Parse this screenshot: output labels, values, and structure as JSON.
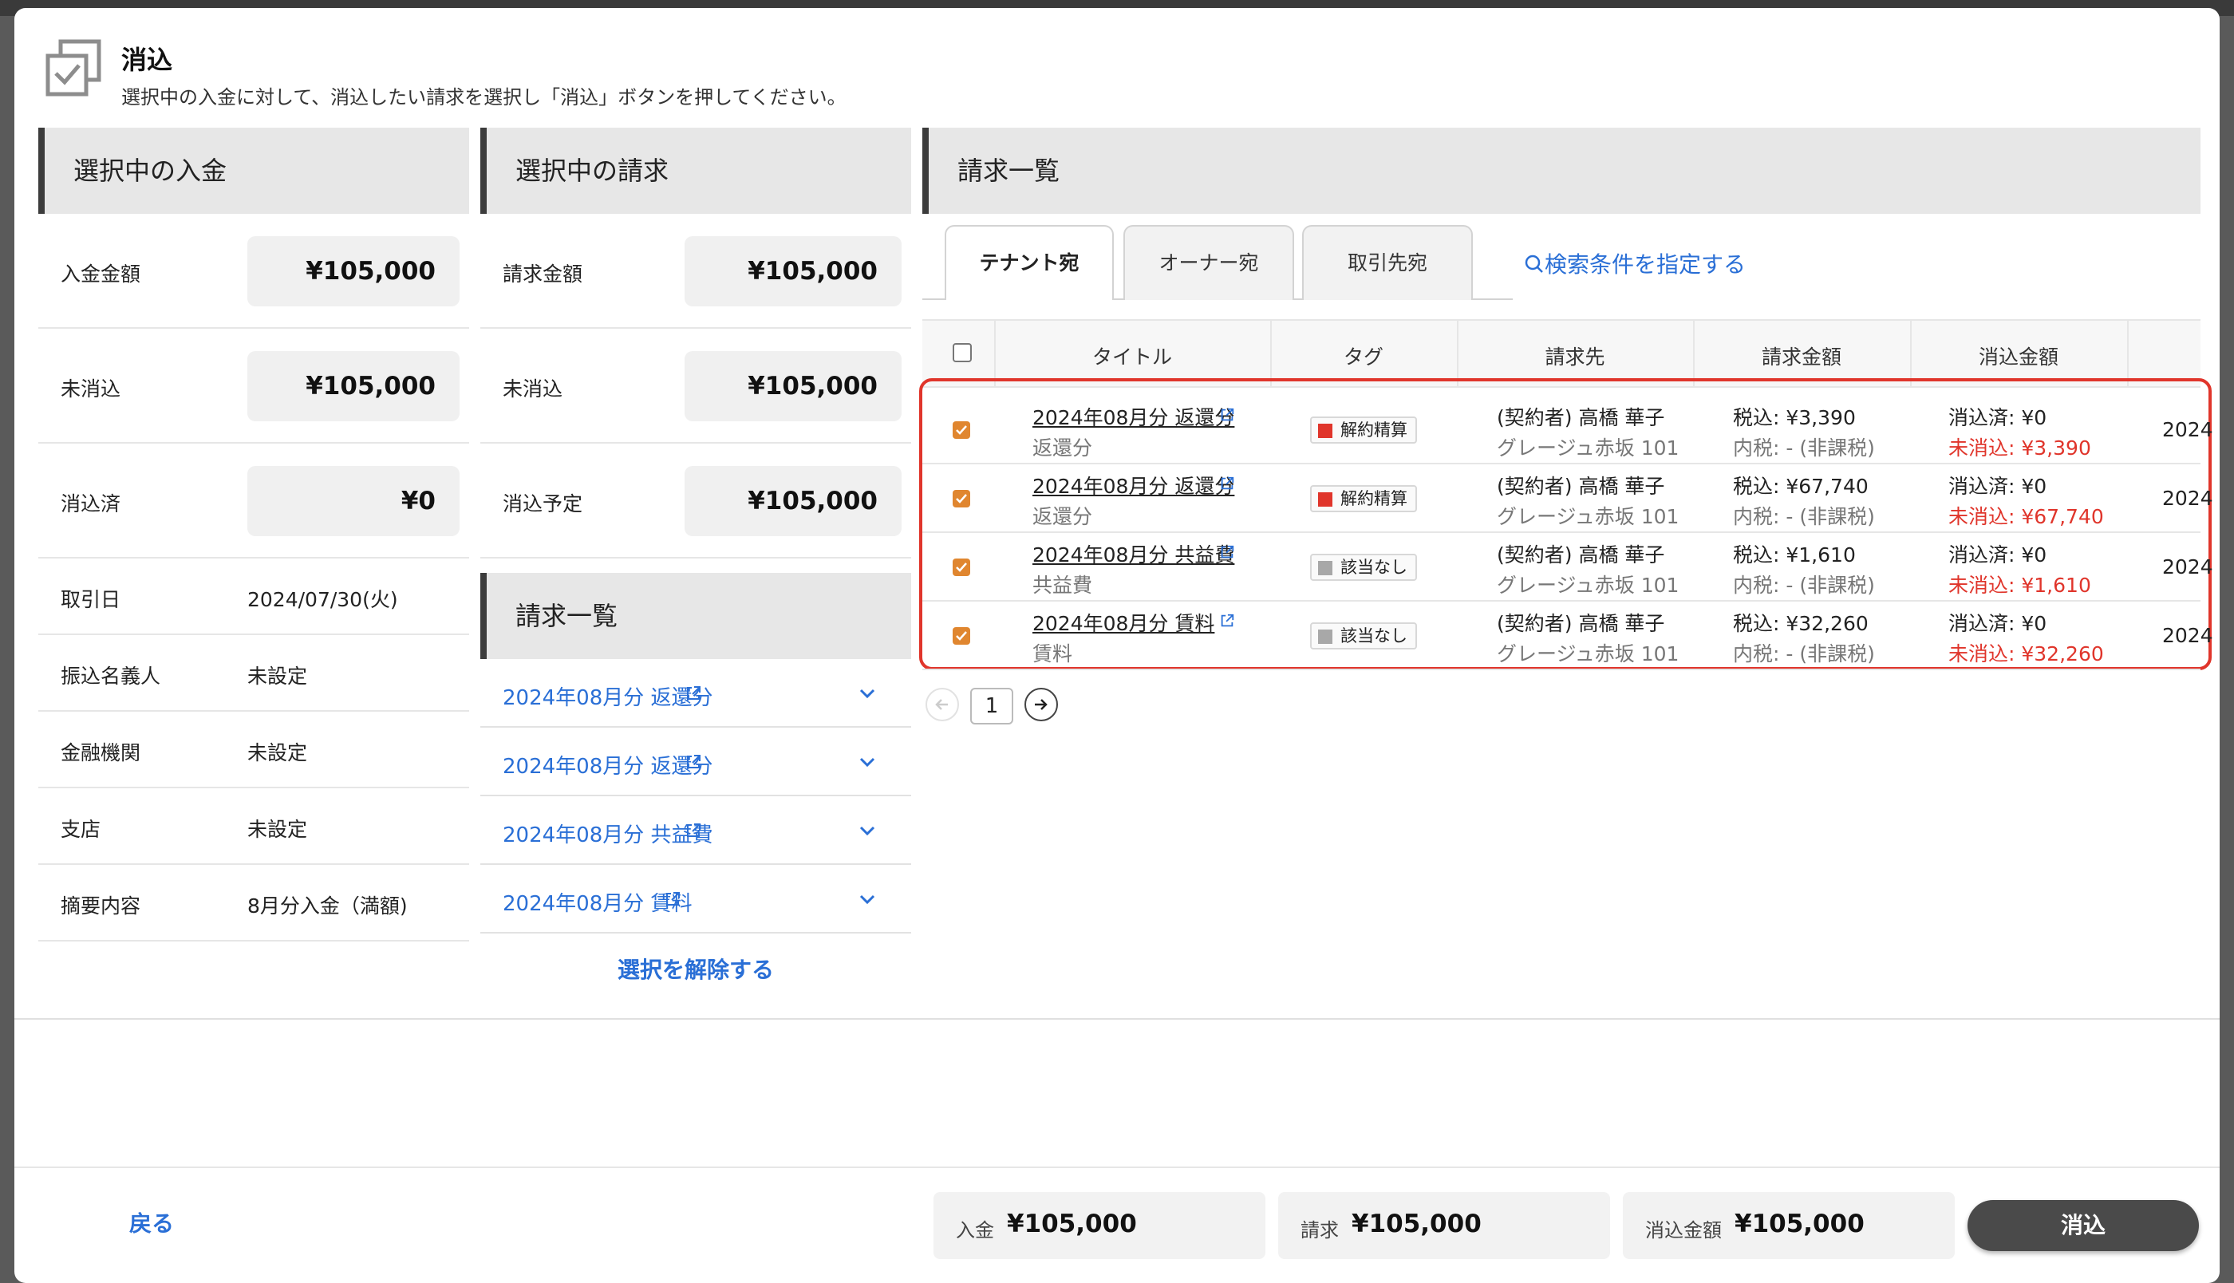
{
  "header": {
    "title": "消込",
    "subtitle": "選択中の入金に対して、消込したい請求を選択し「消込」ボタンを押してください。"
  },
  "payment_panel": {
    "heading": "選択中の入金",
    "rows": [
      {
        "label": "入金金額",
        "value": "¥105,000"
      },
      {
        "label": "未消込",
        "value": "¥105,000"
      },
      {
        "label": "消込済",
        "value": "¥0"
      },
      {
        "label": "取引日",
        "value": "2024/07/30(火)"
      },
      {
        "label": "振込名義人",
        "value": "未設定"
      },
      {
        "label": "金融機関",
        "value": "未設定"
      },
      {
        "label": "支店",
        "value": "未設定"
      },
      {
        "label": "摘要内容",
        "value": "8月分入金（満額)"
      }
    ]
  },
  "invoice_panel": {
    "heading": "選択中の請求",
    "rows": [
      {
        "label": "請求金額",
        "value": "¥105,000"
      },
      {
        "label": "未消込",
        "value": "¥105,000"
      },
      {
        "label": "消込予定",
        "value": "¥105,000"
      }
    ],
    "list_heading": "請求一覧",
    "items": [
      "2024年08月分 返還分",
      "2024年08月分 返還分",
      "2024年08月分 共益費",
      "2024年08月分 賃料"
    ],
    "clear_label": "選択を解除する"
  },
  "list_panel": {
    "heading": "請求一覧",
    "tabs": [
      "テナント宛",
      "オーナー宛",
      "取引先宛"
    ],
    "search_link": "検索条件を指定する",
    "columns": [
      "タイトル",
      "タグ",
      "請求先",
      "請求金額",
      "消込金額"
    ],
    "rows": [
      {
        "title": "2024年08月分 返還分",
        "subtitle": "返還分",
        "tag": "解約精算",
        "tag_color": "#e0352b",
        "payee": "(契約者) 高橋 華子",
        "property": "グレージュ赤坂 101",
        "amount": "税込: ¥3,390",
        "tax": "内税: - (非課税)",
        "cleared": "消込済: ¥0",
        "uncleared": "未消込: ¥3,390",
        "date": "2024"
      },
      {
        "title": "2024年08月分 返還分",
        "subtitle": "返還分",
        "tag": "解約精算",
        "tag_color": "#e0352b",
        "payee": "(契約者) 高橋 華子",
        "property": "グレージュ赤坂 101",
        "amount": "税込: ¥67,740",
        "tax": "内税: - (非課税)",
        "cleared": "消込済: ¥0",
        "uncleared": "未消込: ¥67,740",
        "date": "2024"
      },
      {
        "title": "2024年08月分 共益費",
        "subtitle": "共益費",
        "tag": "該当なし",
        "tag_color": "#a8a8a8",
        "payee": "(契約者) 高橋 華子",
        "property": "グレージュ赤坂 101",
        "amount": "税込: ¥1,610",
        "tax": "内税: - (非課税)",
        "cleared": "消込済: ¥0",
        "uncleared": "未消込: ¥1,610",
        "date": "2024"
      },
      {
        "title": "2024年08月分 賃料",
        "subtitle": "賃料",
        "tag": "該当なし",
        "tag_color": "#a8a8a8",
        "payee": "(契約者) 高橋 華子",
        "property": "グレージュ赤坂 101",
        "amount": "税込: ¥32,260",
        "tax": "内税: - (非課税)",
        "cleared": "消込済: ¥0",
        "uncleared": "未消込: ¥32,260",
        "date": "2024"
      }
    ],
    "pagination": {
      "current": "1"
    }
  },
  "footer": {
    "back_label": "戻る",
    "totals": [
      {
        "label": "入金",
        "value": "¥105,000"
      },
      {
        "label": "請求",
        "value": "¥105,000"
      },
      {
        "label": "消込金額",
        "value": "¥105,000"
      }
    ],
    "submit_label": "消込"
  },
  "colors": {
    "accent": "#2a6fd6",
    "warning": "#e0352b",
    "checkbox": "#e0862f",
    "highlight_border": "#e0352b"
  }
}
